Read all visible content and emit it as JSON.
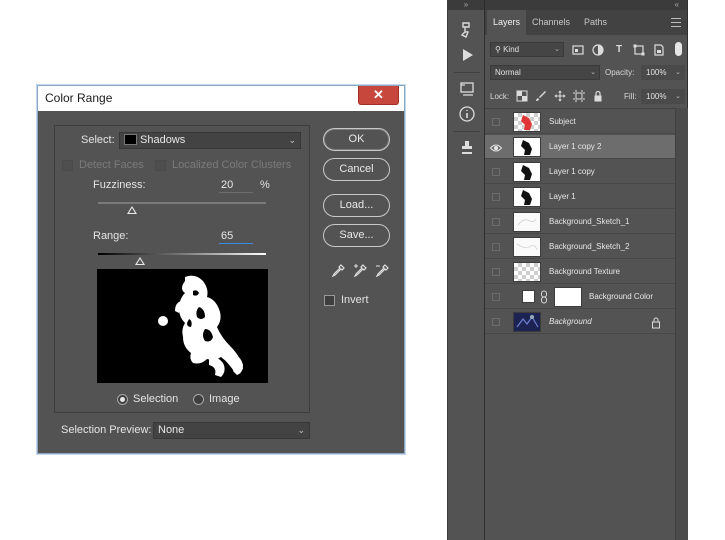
{
  "dialog": {
    "title": "Color Range",
    "close_glyph": "✕",
    "select_label": "Select:",
    "select_value": "Shadows",
    "detect_faces_label": "Detect Faces",
    "localized_label": "Localized Color Clusters",
    "fuzziness_label": "Fuzziness:",
    "fuzziness_value": "20",
    "fuzziness_unit": "%",
    "fuzziness_level": 0.2,
    "range_label": "Range:",
    "range_value": "65",
    "range_level": 0.25,
    "selection_label": "Selection",
    "image_label": "Image",
    "preview_label": "Selection Preview:",
    "preview_value": "None",
    "ok_label": "OK",
    "cancel_label": "Cancel",
    "load_label": "Load...",
    "save_label": "Save...",
    "invert_label": "Invert"
  },
  "layers_panel": {
    "collapse_glyph": "«",
    "tabs": [
      "Layers",
      "Channels",
      "Paths"
    ],
    "kind_label": "Kind",
    "blend_mode": "Normal",
    "opacity_label": "Opacity:",
    "opacity_value": "100%",
    "lock_label": "Lock:",
    "fill_label": "Fill:",
    "fill_value": "100%",
    "layers": [
      {
        "name": "Subject",
        "visible": false,
        "selected": false
      },
      {
        "name": "Layer 1 copy 2",
        "visible": true,
        "selected": true
      },
      {
        "name": "Layer 1 copy",
        "visible": false,
        "selected": false
      },
      {
        "name": "Layer 1",
        "visible": false,
        "selected": false
      },
      {
        "name": "Background_Sketch_1",
        "visible": false,
        "selected": false
      },
      {
        "name": "Background_Sketch_2",
        "visible": false,
        "selected": false
      },
      {
        "name": "Background Texture",
        "visible": false,
        "selected": false
      },
      {
        "name": "Background Color",
        "visible": false,
        "selected": false
      },
      {
        "name": "Background",
        "visible": false,
        "selected": false
      }
    ]
  },
  "toolstrip": {
    "collapse_glyph": "»",
    "icons": [
      "history-brush-icon",
      "play-action-icon",
      "layer-comps-icon",
      "info-icon",
      "clone-source-icon"
    ]
  },
  "colors": {
    "dialog_bg": "#535353",
    "panel_bg": "#535353",
    "selected_row": "#6d6d6d",
    "close_red": "#c8473c",
    "accent_blue": "#3b8be0"
  }
}
